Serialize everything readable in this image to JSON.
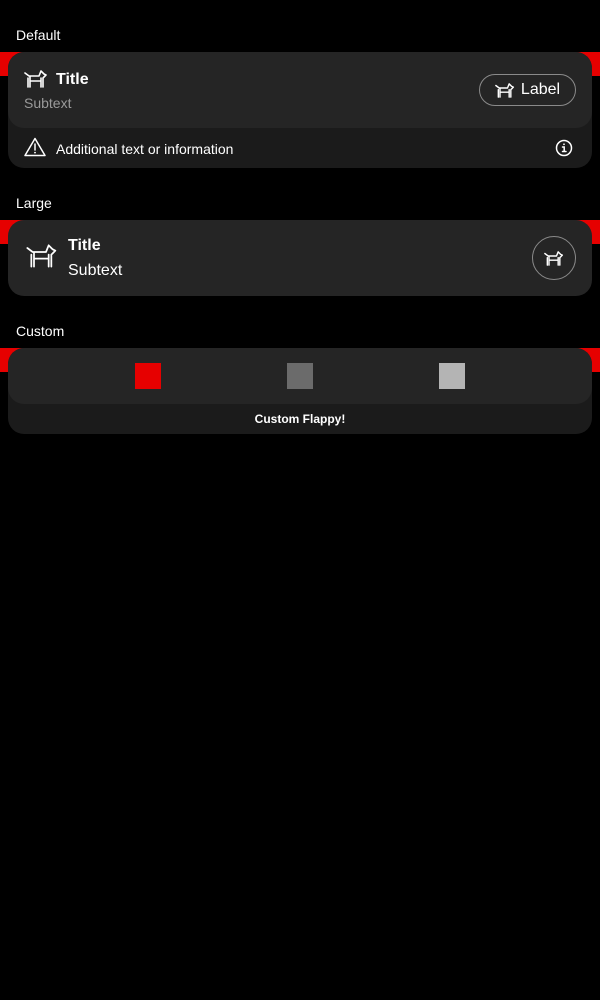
{
  "sections": {
    "default": {
      "label": "Default",
      "title": "Title",
      "subtext": "Subtext",
      "button_label": "Label",
      "footer_text": "Additional text or information",
      "main_icon": "dog-icon",
      "button_icon": "dog-icon",
      "footer_left_icon": "warning-icon",
      "footer_right_icon": "info-icon"
    },
    "large": {
      "label": "Large",
      "title": "Title",
      "subtext": "Subtext",
      "main_icon": "dog-icon",
      "button_icon": "dog-icon"
    },
    "custom": {
      "label": "Custom",
      "footer_text": "Custom Flappy!",
      "swatches": [
        "#e60000",
        "#6b6b6b",
        "#b4b4b4"
      ]
    }
  },
  "colors": {
    "background": "#000000",
    "accent": "#e60000",
    "card": "#252525",
    "card_footer": "#1b1b1b"
  }
}
